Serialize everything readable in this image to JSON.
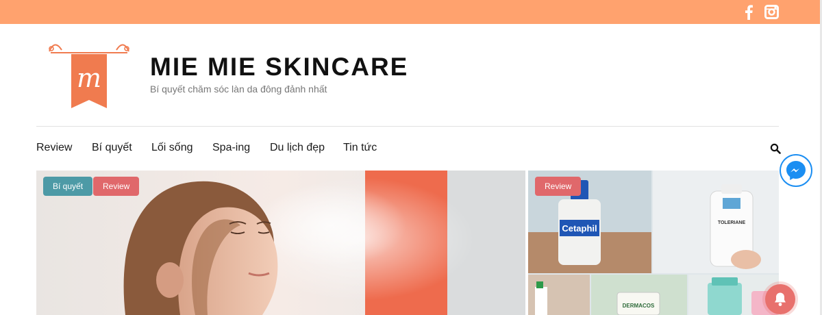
{
  "topbar": {
    "bg_color": "#ffa26e",
    "icons": [
      "facebook-icon",
      "instagram-icon"
    ]
  },
  "site": {
    "title": "MIE MIE SKINCARE",
    "tagline": "Bí quyết chăm sóc làn da đông đảnh nhất",
    "logo_letter": "m",
    "brand_color": "#f07b4f"
  },
  "nav": {
    "items": [
      {
        "label": "Review"
      },
      {
        "label": "Bí quyết"
      },
      {
        "label": "Lối sống"
      },
      {
        "label": "Spa-ing"
      },
      {
        "label": "Du lịch đẹp"
      },
      {
        "label": "Tin tức"
      }
    ],
    "search_icon": "search-icon"
  },
  "featured": {
    "main": {
      "badges": [
        "Bí quyết",
        "Review"
      ],
      "image": "woman-face-mist-spray"
    },
    "side": {
      "badges": [
        "Review"
      ],
      "image": "skincare-products-collage",
      "product_labels": [
        "Cetaphil",
        "TOLERIANE",
        "DERMACOS"
      ]
    }
  },
  "widgets": {
    "messenger_icon": "messenger-icon",
    "notification_icon": "bell-icon"
  },
  "colors": {
    "badge_teal": "#4d9aa6",
    "badge_red": "#e0686b",
    "messenger_blue": "#1b8ef2"
  }
}
